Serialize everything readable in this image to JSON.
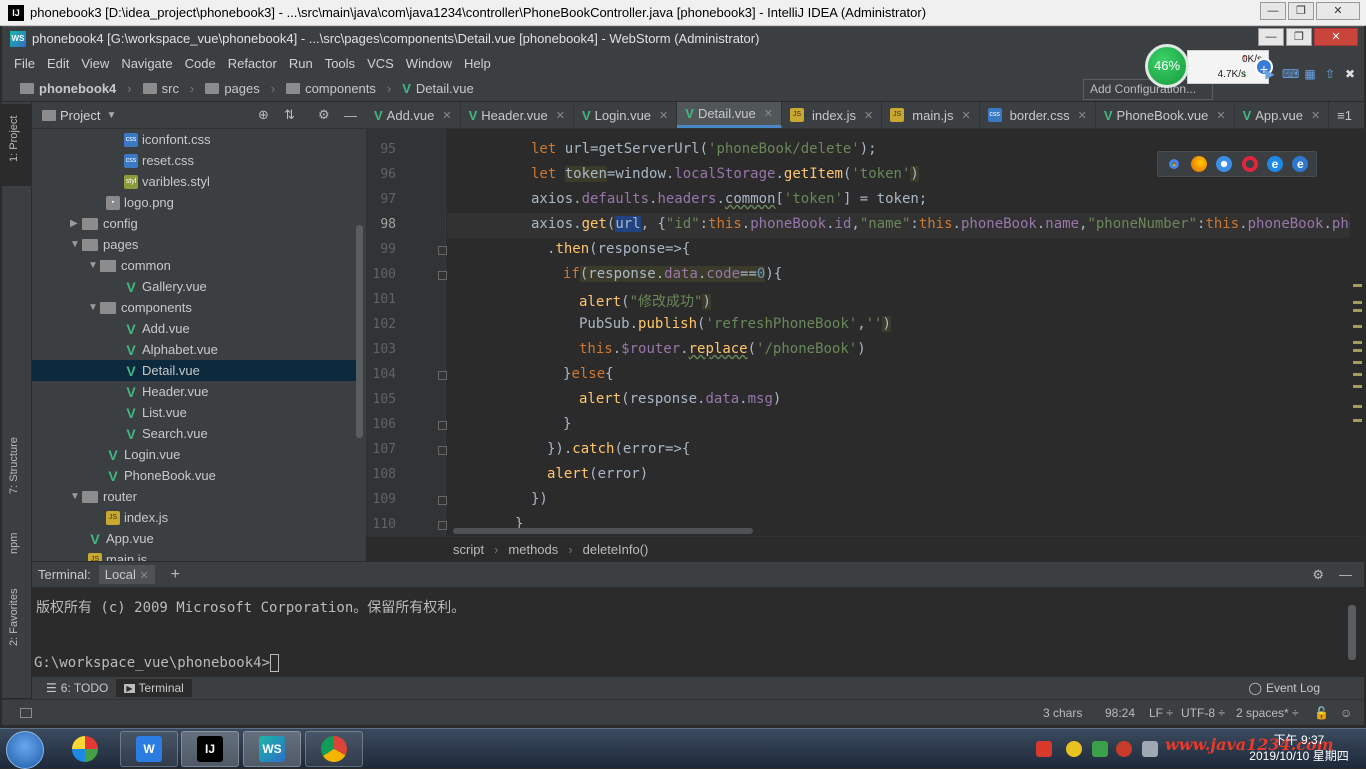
{
  "back_window": {
    "title": "phonebook3 [D:\\idea_project\\phonebook3] - ...\\src\\main\\java\\com\\java1234\\controller\\PhoneBookController.java [phonebook3] - IntelliJ IDEA (Administrator)",
    "icon": "IJ"
  },
  "front_window": {
    "title": "phonebook4 [G:\\workspace_vue\\phonebook4] - ...\\src\\pages\\components\\Detail.vue [phonebook4] - WebStorm (Administrator)",
    "icon": "WS"
  },
  "menu": [
    "File",
    "Edit",
    "View",
    "Navigate",
    "Code",
    "Refactor",
    "Run",
    "Tools",
    "VCS",
    "Window",
    "Help"
  ],
  "navbar": {
    "project": "phonebook4",
    "crumbs": [
      "src",
      "pages",
      "components"
    ],
    "file": "Detail.vue",
    "add_config": "Add Configuration..."
  },
  "speed": {
    "percent": "46%",
    "up": "0K/s",
    "down": "4.7K/s"
  },
  "side_tabs": {
    "project": "1: Project",
    "structure": "7: Structure",
    "npm": "npm",
    "favorites": "2: Favorites"
  },
  "project_panel": {
    "title": "Project"
  },
  "tree": [
    {
      "label": "iconfont.css",
      "icon": "css"
    },
    {
      "label": "reset.css",
      "icon": "css"
    },
    {
      "label": "varibles.styl",
      "icon": "styl"
    },
    {
      "label": "logo.png",
      "icon": "png"
    },
    {
      "label": "config",
      "icon": "folder"
    },
    {
      "label": "pages",
      "icon": "folder"
    },
    {
      "label": "common",
      "icon": "folder"
    },
    {
      "label": "Gallery.vue",
      "icon": "vue"
    },
    {
      "label": "components",
      "icon": "folder"
    },
    {
      "label": "Add.vue",
      "icon": "vue"
    },
    {
      "label": "Alphabet.vue",
      "icon": "vue"
    },
    {
      "label": "Detail.vue",
      "icon": "vue"
    },
    {
      "label": "Header.vue",
      "icon": "vue"
    },
    {
      "label": "List.vue",
      "icon": "vue"
    },
    {
      "label": "Search.vue",
      "icon": "vue"
    },
    {
      "label": "Login.vue",
      "icon": "vue"
    },
    {
      "label": "PhoneBook.vue",
      "icon": "vue"
    },
    {
      "label": "router",
      "icon": "folder"
    },
    {
      "label": "index.js",
      "icon": "js"
    },
    {
      "label": "App.vue",
      "icon": "vue"
    },
    {
      "label": "main.js",
      "icon": "js"
    }
  ],
  "tabs": [
    {
      "label": "Add.vue",
      "icon": "vue"
    },
    {
      "label": "Header.vue",
      "icon": "vue"
    },
    {
      "label": "Login.vue",
      "icon": "vue"
    },
    {
      "label": "Detail.vue",
      "icon": "vue"
    },
    {
      "label": "index.js",
      "icon": "js"
    },
    {
      "label": "main.js",
      "icon": "js"
    },
    {
      "label": "border.css",
      "icon": "css"
    },
    {
      "label": "PhoneBook.vue",
      "icon": "vue"
    },
    {
      "label": "App.vue",
      "icon": "vue"
    }
  ],
  "tabs_more": "≡1",
  "line_numbers": [
    "95",
    "96",
    "97",
    "98",
    "99",
    "100",
    "101",
    "102",
    "103",
    "104",
    "105",
    "106",
    "107",
    "108",
    "109",
    "110"
  ],
  "code": {
    "l95a": "let",
    "l95b": " url=getServerUrl(",
    "l95c": "'phoneBook/delete'",
    "l95d": ");",
    "l96a": "let",
    "l96b": "token",
    "l96c": "=window.",
    "l96d": "localStorage",
    "l96e": ".",
    "l96f": "getItem",
    "l96g": "(",
    "l96h": "'token'",
    "l96i": ")",
    "l97a": "axios.",
    "l97b": "defaults",
    "l97c": ".",
    "l97d": "headers",
    "l97e": ".",
    "l97f": "common",
    "l97g": "[",
    "l97h": "'token'",
    "l97i": "] = token;",
    "l98a": "axios.",
    "l98b": "get",
    "l98c": "(",
    "l98d": "url",
    "l98e": ", {",
    "l98f": "\"id\"",
    "l98g": ":",
    "l98h": "this",
    "l98i": ".",
    "l98j": "phoneBook",
    "l98k": ".",
    "l98l": "id",
    "l98m": ",",
    "l98n": "\"name\"",
    "l98o": ":",
    "l98p": "this",
    "l98q": ".",
    "l98r": "phoneBook",
    "l98s": ".",
    "l98t": "name",
    "l98u": ",",
    "l98v": "\"phoneNumber\"",
    "l98w": ":",
    "l98x": "this",
    "l98y": ".",
    "l98z": "phoneBook",
    "l98aa": ".",
    "l98ab": "phoneNumbe",
    "l99a": ".",
    "l99b": "then",
    "l99c": "(response=>{",
    "l100a": "if",
    "l100b": "(response.",
    "l100c": "data",
    "l100d": ".",
    "l100e": "code",
    "l100f": "==",
    "l100g": "0",
    "l100h": "){",
    "l101a": "alert",
    "l101b": "(",
    "l101c": "\"修改成功\"",
    "l101d": ")",
    "l102a": "PubSub.",
    "l102b": "publish",
    "l102c": "(",
    "l102d": "'refreshPhoneBook'",
    "l102e": ",",
    "l102f": "''",
    "l102g": ")",
    "l103a": "this",
    "l103b": ".",
    "l103c": "$router",
    "l103d": ".",
    "l103e": "replace",
    "l103f": "(",
    "l103g": "'/phoneBook'",
    "l103h": ")",
    "l104a": "}",
    "l104b": "else",
    "l104c": "{",
    "l105a": "alert",
    "l105b": "(response.",
    "l105c": "data",
    "l105d": ".",
    "l105e": "msg",
    "l105f": ")",
    "l106": "}",
    "l107a": "}).",
    "l107b": "catch",
    "l107c": "(error=>{",
    "l108a": "alert",
    "l108b": "(error)",
    "l109": "})",
    "l110": "}"
  },
  "code_crumbs": [
    "script",
    "methods",
    "deleteInfo()"
  ],
  "terminal": {
    "title": "Terminal:",
    "tab": "Local",
    "copyright": "版权所有 (c) 2009 Microsoft Corporation。保留所有权利。",
    "prompt": "G:\\workspace_vue\\phonebook4>"
  },
  "bottom_tabs": {
    "todo": "6: TODO",
    "terminal": "Terminal",
    "event_log": "Event Log"
  },
  "status": {
    "chars": "3 chars",
    "pos": "98:24",
    "lf": "LF ÷",
    "enc": "UTF-8 ÷",
    "indent": "2 spaces* ÷"
  },
  "taskbar": {
    "time": "下午 9:37",
    "date": "2019/10/10 星期四",
    "watermark": "www.java1234.com"
  },
  "colors": {
    "keyword": "#cc7832",
    "string": "#6a8759",
    "function": "#ffc66d",
    "property": "#9876aa",
    "number": "#6897bb",
    "vue": "#41b883"
  }
}
